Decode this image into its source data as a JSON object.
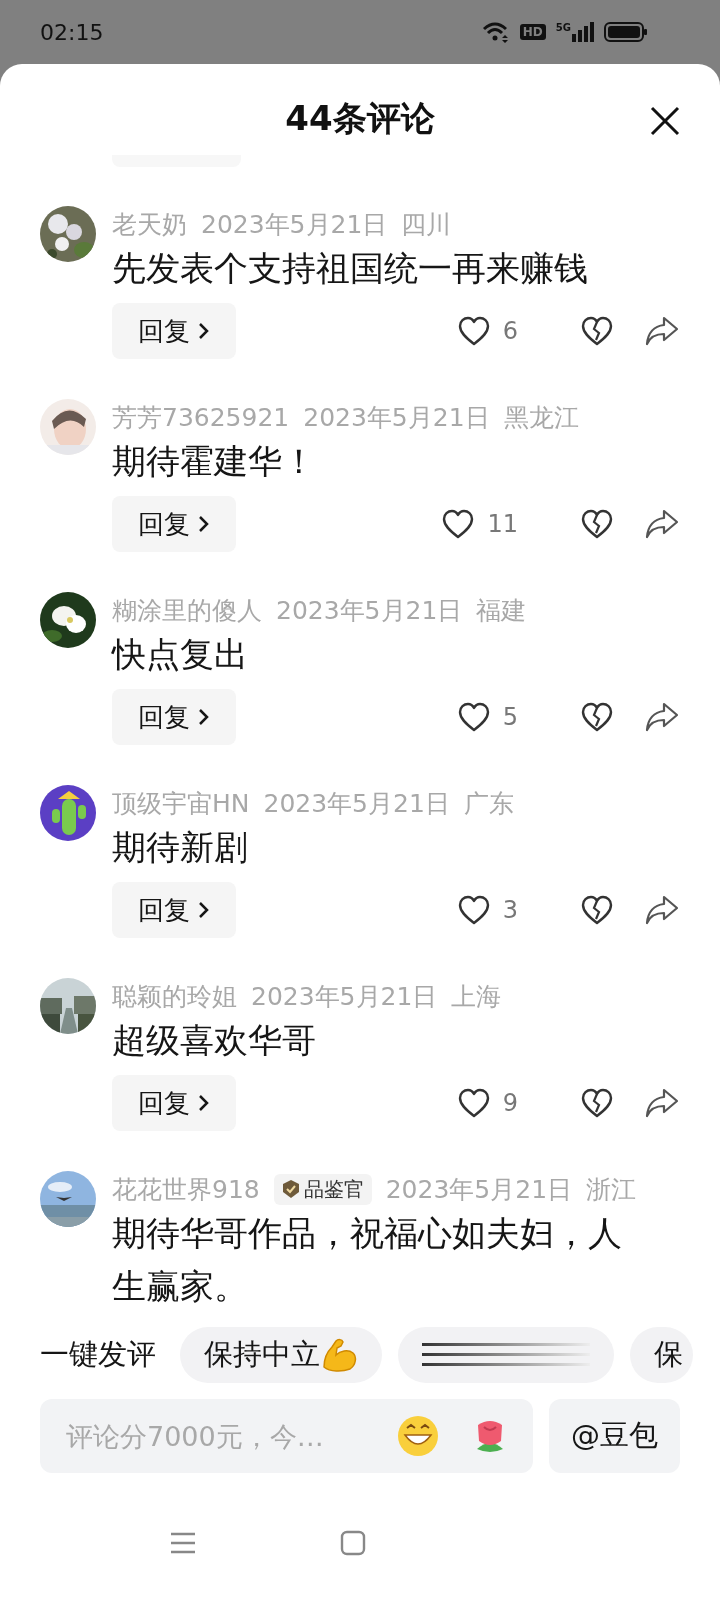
{
  "status_bar": {
    "time": "02:15",
    "hd_label": "HD",
    "network_label": "5G"
  },
  "header": {
    "title": "44条评论"
  },
  "comments": [
    {
      "user": "老天奶",
      "date": "2023年5月21日",
      "region": "四川",
      "text": "先发表个支持祖国统一再来赚钱",
      "reply": "回复",
      "likes": "6"
    },
    {
      "user": "芳芳73625921",
      "date": "2023年5月21日",
      "region": "黑龙江",
      "text": "期待霍建华！",
      "reply": "回复",
      "likes": "11"
    },
    {
      "user": "糊涂里的傻人",
      "date": "2023年5月21日",
      "region": "福建",
      "text": "快点复出",
      "reply": "回复",
      "likes": "5"
    },
    {
      "user": "顶级宇宙HN",
      "date": "2023年5月21日",
      "region": "广东",
      "text": "期待新剧",
      "reply": "回复",
      "likes": "3"
    },
    {
      "user": "聪颖的玲姐",
      "date": "2023年5月21日",
      "region": "上海",
      "text": "超级喜欢华哥",
      "reply": "回复",
      "likes": "9"
    },
    {
      "user": "花花世界918",
      "badge": "品鉴官",
      "date": "2023年5月21日",
      "region": "浙江",
      "text": "期待华哥作品，祝福心如夫妇，人生赢家。"
    }
  ],
  "quick_comments": {
    "label": "一键发评",
    "chips": [
      {
        "kind": "text",
        "text": "保持中立"
      },
      {
        "kind": "loading"
      },
      {
        "kind": "text",
        "text": "保"
      }
    ]
  },
  "composer": {
    "placeholder": "评论分7000元，今…",
    "mention_button": "@豆包"
  }
}
